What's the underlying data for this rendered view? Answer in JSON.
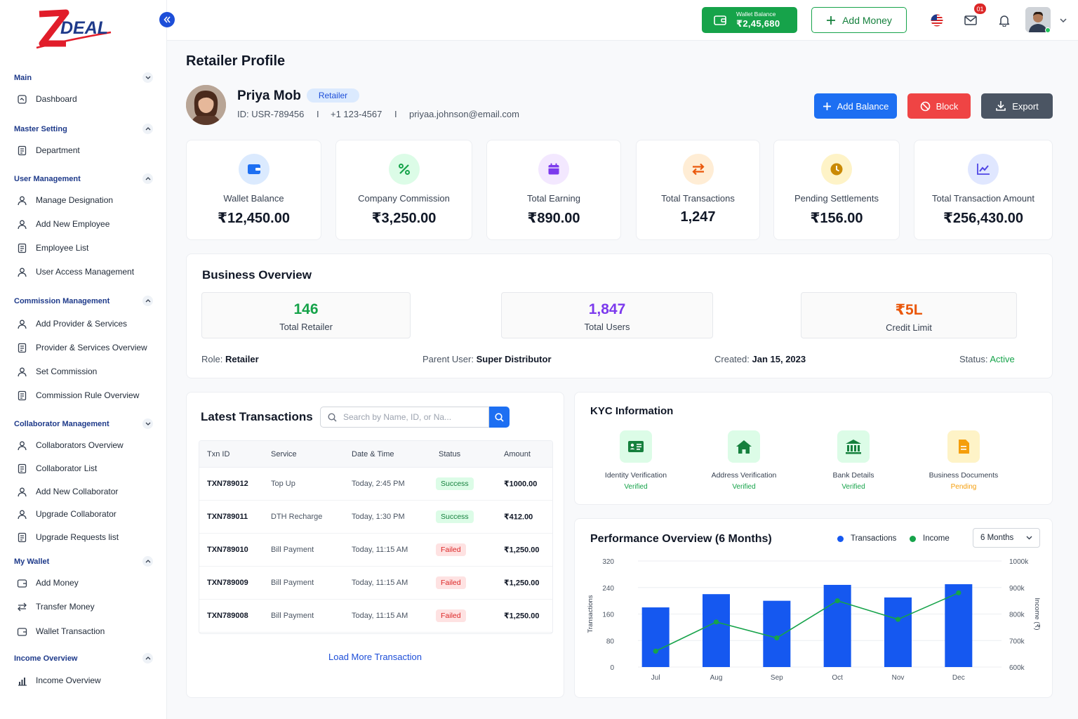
{
  "brand": {
    "logo_text": "ZDEAL"
  },
  "header": {
    "wallet_label": "Wallet Balance",
    "wallet_value": "₹2,45,680",
    "add_money": "Add Money",
    "notification_count": "01"
  },
  "sidebar": {
    "sections": [
      {
        "title": "Main",
        "items": [
          "Dashboard"
        ]
      },
      {
        "title": "Master Setting",
        "items": [
          "Department"
        ]
      },
      {
        "title": "User Management",
        "items": [
          "Manage Designation",
          "Add New Employee",
          "Employee List",
          "User Access Management"
        ]
      },
      {
        "title": "Commission Management",
        "items": [
          "Add Provider & Services",
          "Provider & Services Overview",
          "Set Commission",
          "Commission Rule Overview"
        ]
      },
      {
        "title": "Collaborator Management",
        "items": [
          "Collaborators Overview",
          "Collaborator List",
          "Add New Collaborator",
          "Upgrade Collaborator",
          "Upgrade Requests list"
        ]
      },
      {
        "title": "My Wallet",
        "items": [
          "Add Money",
          "Transfer Money",
          "Wallet Transaction"
        ]
      },
      {
        "title": "Income Overview",
        "items": [
          "Income Overview"
        ]
      }
    ]
  },
  "page": {
    "title": "Retailer Profile"
  },
  "profile": {
    "name": "Priya Mob",
    "role_badge": "Retailer",
    "id": "ID: USR-789456",
    "phone": "+1 123-4567",
    "email": "priyaa.johnson@email.com",
    "sep": "I"
  },
  "actions": {
    "add_balance": "Add Balance",
    "block": "Block",
    "export": "Export"
  },
  "stats": [
    {
      "label": "Wallet Balance",
      "value": "₹12,450.00"
    },
    {
      "label": "Company Commission",
      "value": "₹3,250.00"
    },
    {
      "label": "Total Earning",
      "value": "₹890.00"
    },
    {
      "label": "Total Transactions",
      "value": "1,247"
    },
    {
      "label": "Pending Settlements",
      "value": "₹156.00"
    },
    {
      "label": "Total Transaction Amount",
      "value": "₹256,430.00"
    }
  ],
  "business": {
    "title": "Business Overview",
    "boxes": [
      {
        "value": "146",
        "label": "Total Retailer",
        "color": "#16a34a"
      },
      {
        "value": "1,847",
        "label": "Total Users",
        "color": "#7c3aed"
      },
      {
        "value": "₹5L",
        "label": "Credit Limit",
        "color": "#ea580c"
      }
    ],
    "role_label": "Role:",
    "role": "Retailer",
    "parent_label": "Parent User:",
    "parent": "Super Distributor",
    "created_label": "Created:",
    "created": "Jan 15, 2023",
    "status_label": "Status:",
    "status": "Active"
  },
  "transactions": {
    "title": "Latest Transactions",
    "search_placeholder": "Search by Name, ID, or Na...",
    "columns": [
      "Txn ID",
      "Service",
      "Date & Time",
      "Status",
      "Amount"
    ],
    "rows": [
      {
        "id": "TXN789012",
        "service": "Top Up",
        "time": "Today, 2:45 PM",
        "status": "Success",
        "amount": "₹1000.00"
      },
      {
        "id": "TXN789011",
        "service": "DTH Recharge",
        "time": "Today, 1:30 PM",
        "status": "Success",
        "amount": "₹412.00"
      },
      {
        "id": "TXN789010",
        "service": "Bill Payment",
        "time": "Today, 11:15 AM",
        "status": "Failed",
        "amount": "₹1,250.00"
      },
      {
        "id": "TXN789009",
        "service": "Bill Payment",
        "time": "Today, 11:15 AM",
        "status": "Failed",
        "amount": "₹1,250.00"
      },
      {
        "id": "TXN789008",
        "service": "Bill Payment",
        "time": "Today, 11:15 AM",
        "status": "Failed",
        "amount": "₹1,250.00"
      }
    ],
    "load_more": "Load More Transaction"
  },
  "kyc": {
    "title": "KYC Information",
    "items": [
      {
        "label": "Identity Verification",
        "status": "Verified",
        "icon": "id-card-icon"
      },
      {
        "label": "Address Verification",
        "status": "Verified",
        "icon": "home-icon"
      },
      {
        "label": "Bank Details",
        "status": "Verified",
        "icon": "bank-icon"
      },
      {
        "label": "Business Documents",
        "status": "Pending",
        "icon": "document-icon"
      }
    ]
  },
  "performance": {
    "title": "Performance Overview (6 Months)",
    "legend_transactions": "Transactions",
    "legend_income": "Income",
    "period": "6 Months"
  },
  "chart_data": {
    "type": "bar",
    "title": "Performance Overview (6 Months)",
    "categories": [
      "Jul",
      "Aug",
      "Sep",
      "Oct",
      "Nov",
      "Dec"
    ],
    "series": [
      {
        "name": "Transactions",
        "type": "bar",
        "axis": "left",
        "color": "#1558f0",
        "values": [
          180,
          220,
          200,
          248,
          210,
          250
        ]
      },
      {
        "name": "Income",
        "type": "line",
        "axis": "right",
        "color": "#16a34a",
        "values": [
          660000,
          770000,
          710000,
          850000,
          780000,
          880000
        ]
      }
    ],
    "ylabel": "Transactions",
    "y2label": "Income (₹)",
    "ylim": [
      0,
      320
    ],
    "y2lim": [
      600000,
      1000000
    ],
    "yticks": [
      "0",
      "80",
      "160",
      "240",
      "320"
    ],
    "y2ticks": [
      "600k",
      "700k",
      "800k",
      "900k",
      "1000k"
    ],
    "grid": true,
    "legend": "top-right"
  },
  "colors": {
    "primary": "#1d6ff2",
    "success": "#16a34a",
    "danger": "#ef4444",
    "dark": "#4b5563"
  }
}
